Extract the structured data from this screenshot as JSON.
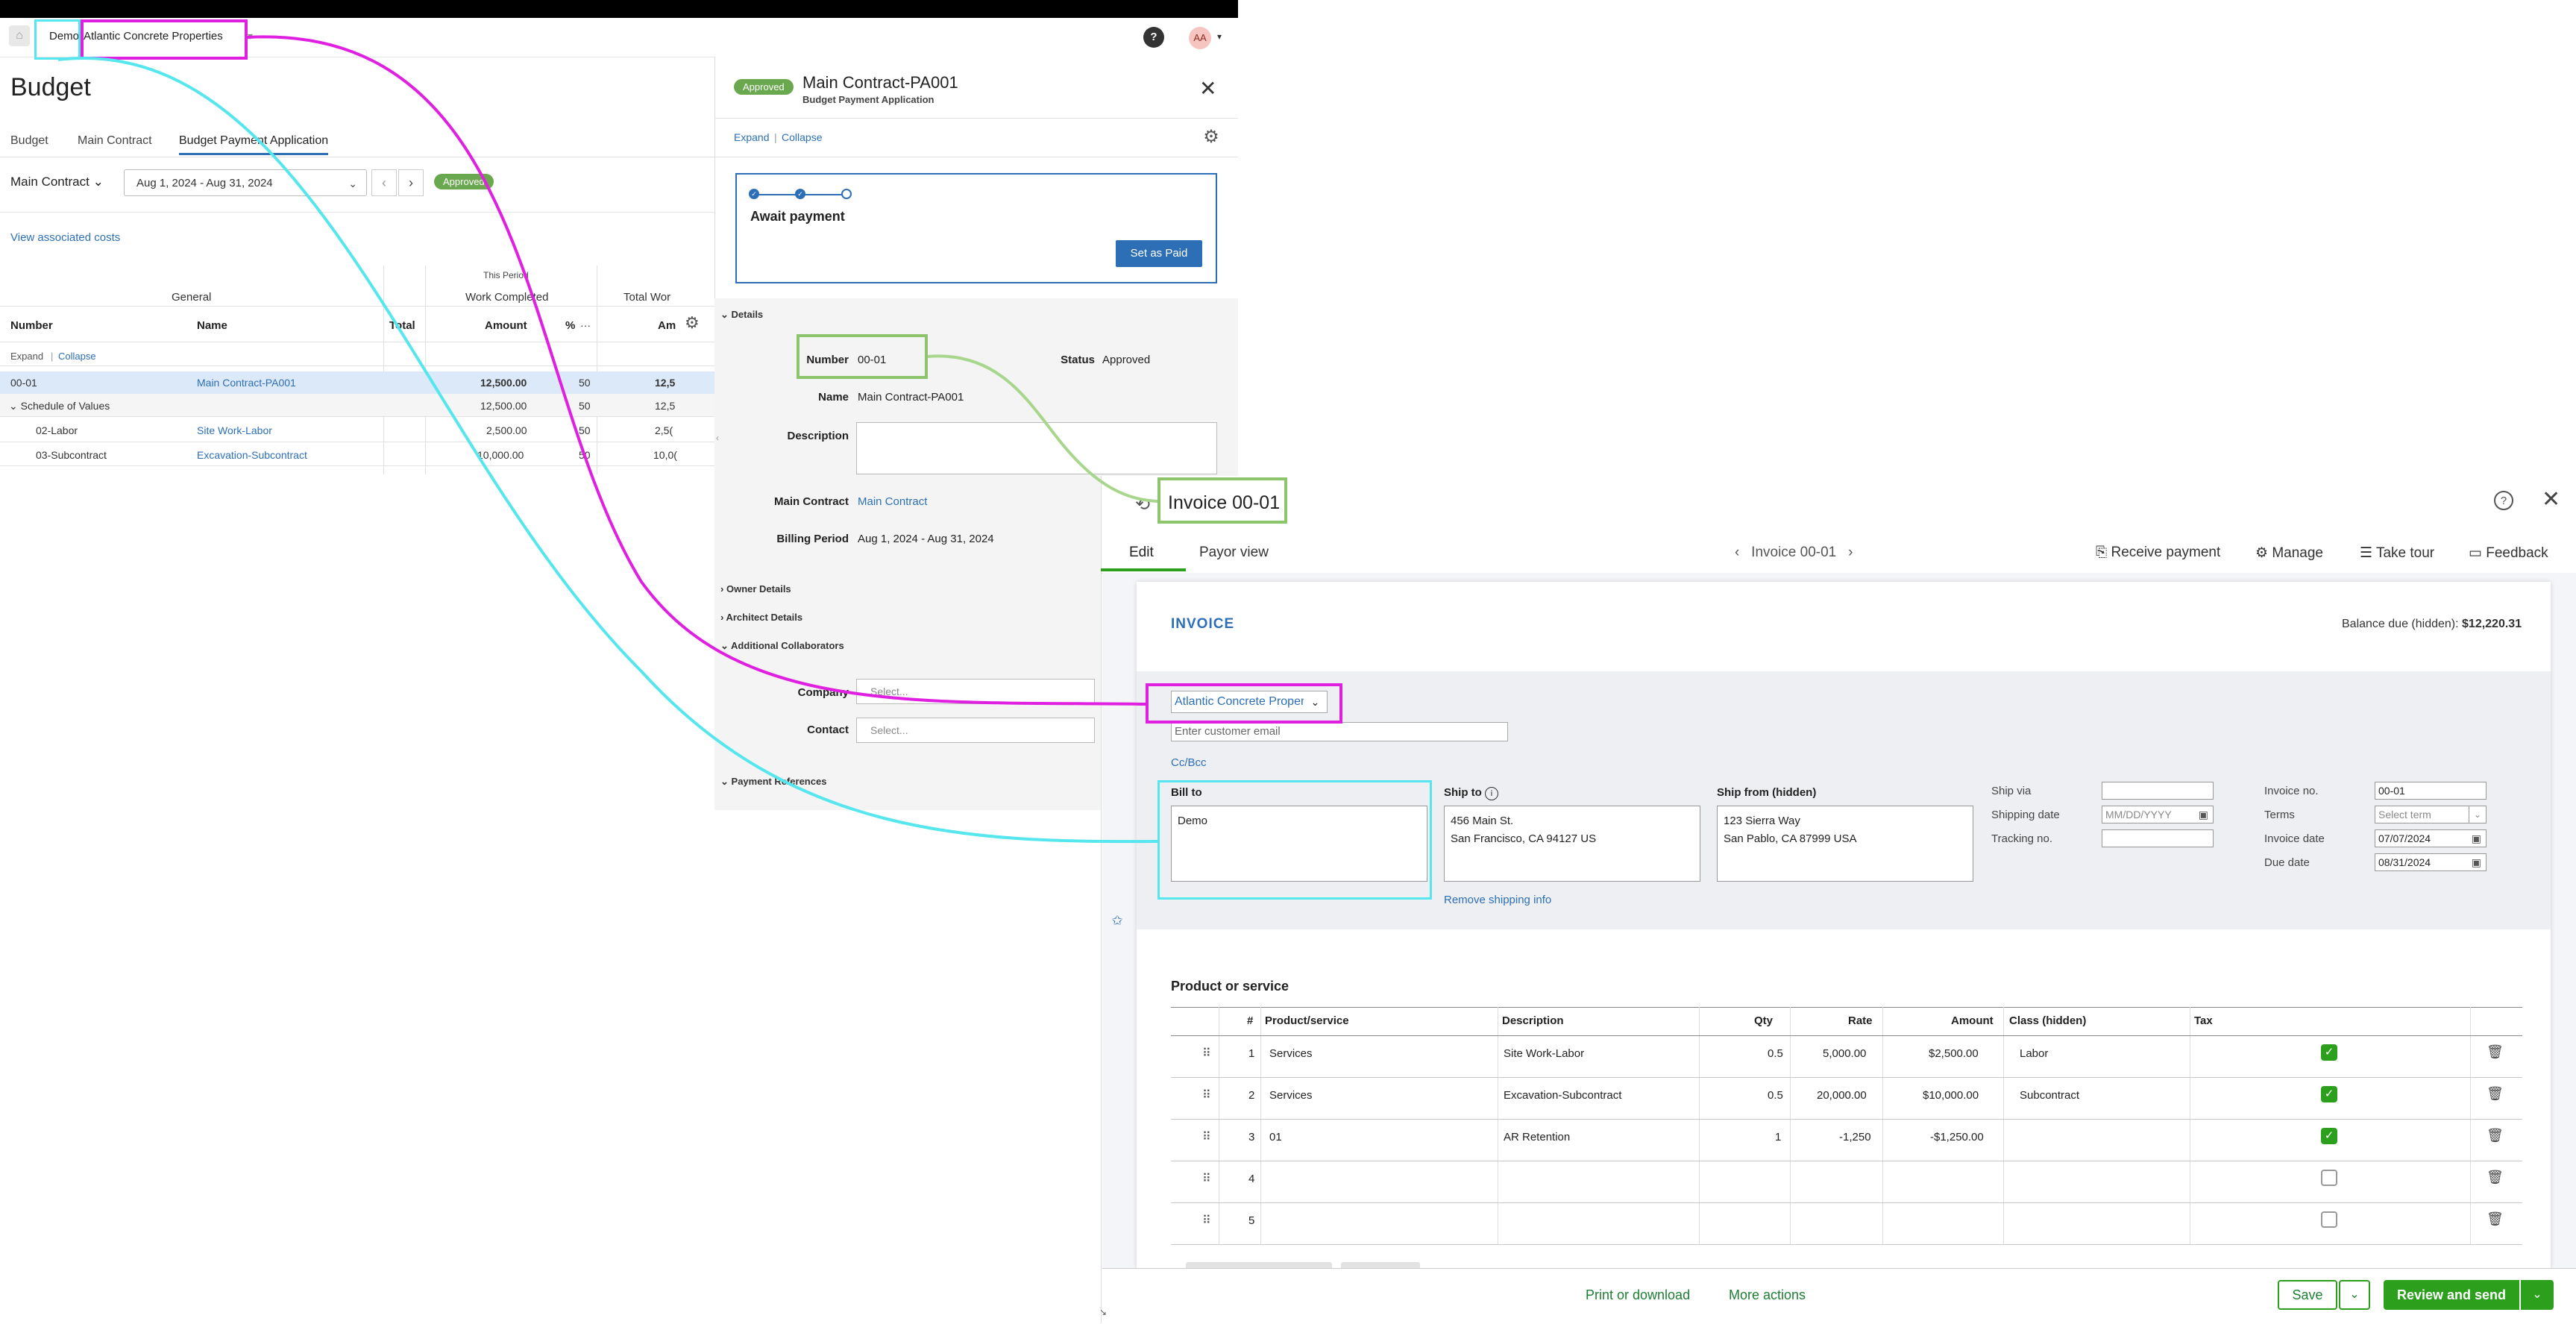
{
  "app": {
    "breadcrumb_company": "Demo",
    "breadcrumb_project": "Atlantic Concrete Properties",
    "help_label": "?",
    "avatar_initials": "AA"
  },
  "budget": {
    "title": "Budget",
    "tabs": [
      "Budget",
      "Main Contract",
      "Budget Payment Application"
    ],
    "contract_select": "Main Contract",
    "date_range": "Aug 1, 2024 - Aug 31, 2024",
    "status": "Approved",
    "view_costs_link": "View associated costs",
    "group_headers": {
      "this_period": "This Period",
      "general": "General",
      "work_completed": "Work Completed",
      "total_work": "Total Wor"
    },
    "columns": {
      "number": "Number",
      "name": "Name",
      "total": "Total",
      "amount": "Amount",
      "percent": "%",
      "more": "···",
      "am": "Am"
    },
    "expand": "Expand",
    "collapse": "Collapse",
    "rows": [
      {
        "number": "00-01",
        "name": "Main Contract-PA001",
        "amount": "12,500.00",
        "pct": "50",
        "total": "12,5"
      },
      {
        "number": "Schedule of Values",
        "name": "",
        "amount": "12,500.00",
        "pct": "50",
        "total": "12,5"
      },
      {
        "number": "02-Labor",
        "name": "Site Work-Labor",
        "amount": "2,500.00",
        "pct": "50",
        "total": "2,5("
      },
      {
        "number": "03-Subcontract",
        "name": "Excavation-Subcontract",
        "amount": "10,000.00",
        "pct": "50",
        "total": "10,0("
      }
    ]
  },
  "payapp": {
    "status": "Approved",
    "title": "Main Contract-PA001",
    "subtitle": "Budget Payment Application",
    "expand": "Expand",
    "collapse": "Collapse",
    "await_title": "Await payment",
    "set_paid": "Set as Paid",
    "sections": {
      "details": "Details",
      "owner": "Owner Details",
      "architect": "Architect Details",
      "collab": "Additional Collaborators",
      "payref": "Payment References"
    },
    "fields": {
      "number_label": "Number",
      "number": "00-01",
      "status_label": "Status",
      "status": "Approved",
      "name_label": "Name",
      "name": "Main Contract-PA001",
      "description_label": "Description",
      "contract_label": "Main Contract",
      "contract": "Main Contract",
      "period_label": "Billing Period",
      "period": "Aug 1, 2024 - Aug 31, 2024",
      "company_label": "Company",
      "contact_label": "Contact",
      "select_placeholder": "Select..."
    }
  },
  "invoice": {
    "title": "Invoice 00-01",
    "tabs": [
      "Edit",
      "Payor view"
    ],
    "nav_title": "Invoice 00-01",
    "actions": [
      "Receive payment",
      "Manage",
      "Take tour",
      "Feedback"
    ],
    "heading": "INVOICE",
    "balance_label": "Balance due (hidden):",
    "balance_value": "$12,220.31",
    "customer": "Atlantic Concrete Properties",
    "email_placeholder": "Enter customer email",
    "ccbcc": "Cc/Bcc",
    "bill_to_label": "Bill to",
    "bill_to": "Demo",
    "ship_to_label": "Ship to",
    "ship_to_1": "456 Main St.",
    "ship_to_2": "San Francisco, CA  94127 US",
    "ship_from_label": "Ship from (hidden)",
    "ship_from_1": "123 Sierra Way",
    "ship_from_2": "San Pablo, CA  87999 USA",
    "remove_shipping": "Remove shipping info",
    "ship_via_label": "Ship via",
    "shipping_date_label": "Shipping date",
    "shipping_date_placeholder": "MM/DD/YYYY",
    "tracking_label": "Tracking no.",
    "invoice_no_label": "Invoice no.",
    "invoice_no": "00-01",
    "terms_label": "Terms",
    "terms_placeholder": "Select term",
    "invoice_date_label": "Invoice date",
    "invoice_date": "07/07/2024",
    "due_date_label": "Due date",
    "due_date": "08/31/2024",
    "product_heading": "Product or service",
    "columns": {
      "num": "#",
      "product": "Product/service",
      "description": "Description",
      "qty": "Qty",
      "rate": "Rate",
      "amount": "Amount",
      "class": "Class (hidden)",
      "tax": "Tax"
    },
    "lines": [
      {
        "num": "1",
        "product": "Services",
        "description": "Site Work-Labor",
        "qty": "0.5",
        "rate": "5,000.00",
        "amount": "$2,500.00",
        "class": "Labor",
        "tax": true
      },
      {
        "num": "2",
        "product": "Services",
        "description": "Excavation-Subcontract",
        "qty": "0.5",
        "rate": "20,000.00",
        "amount": "$10,000.00",
        "class": "Subcontract",
        "tax": true
      },
      {
        "num": "3",
        "product": "01",
        "description": "AR Retention",
        "qty": "1",
        "rate": "-1,250",
        "amount": "-$1,250.00",
        "class": "",
        "tax": true
      },
      {
        "num": "4",
        "product": "",
        "description": "",
        "qty": "",
        "rate": "",
        "amount": "",
        "class": "",
        "tax": false
      },
      {
        "num": "5",
        "product": "",
        "description": "",
        "qty": "",
        "rate": "",
        "amount": "",
        "class": "",
        "tax": false
      }
    ],
    "footer": {
      "print": "Print or download",
      "more": "More actions",
      "save": "Save",
      "review_send": "Review and send"
    }
  },
  "colors": {
    "highlight_customer": "#e020e0",
    "highlight_billto": "#55e6ee",
    "highlight_number": "#8cc56b",
    "accent_blue": "#2c6fb7",
    "accent_green": "#2ca01c"
  }
}
